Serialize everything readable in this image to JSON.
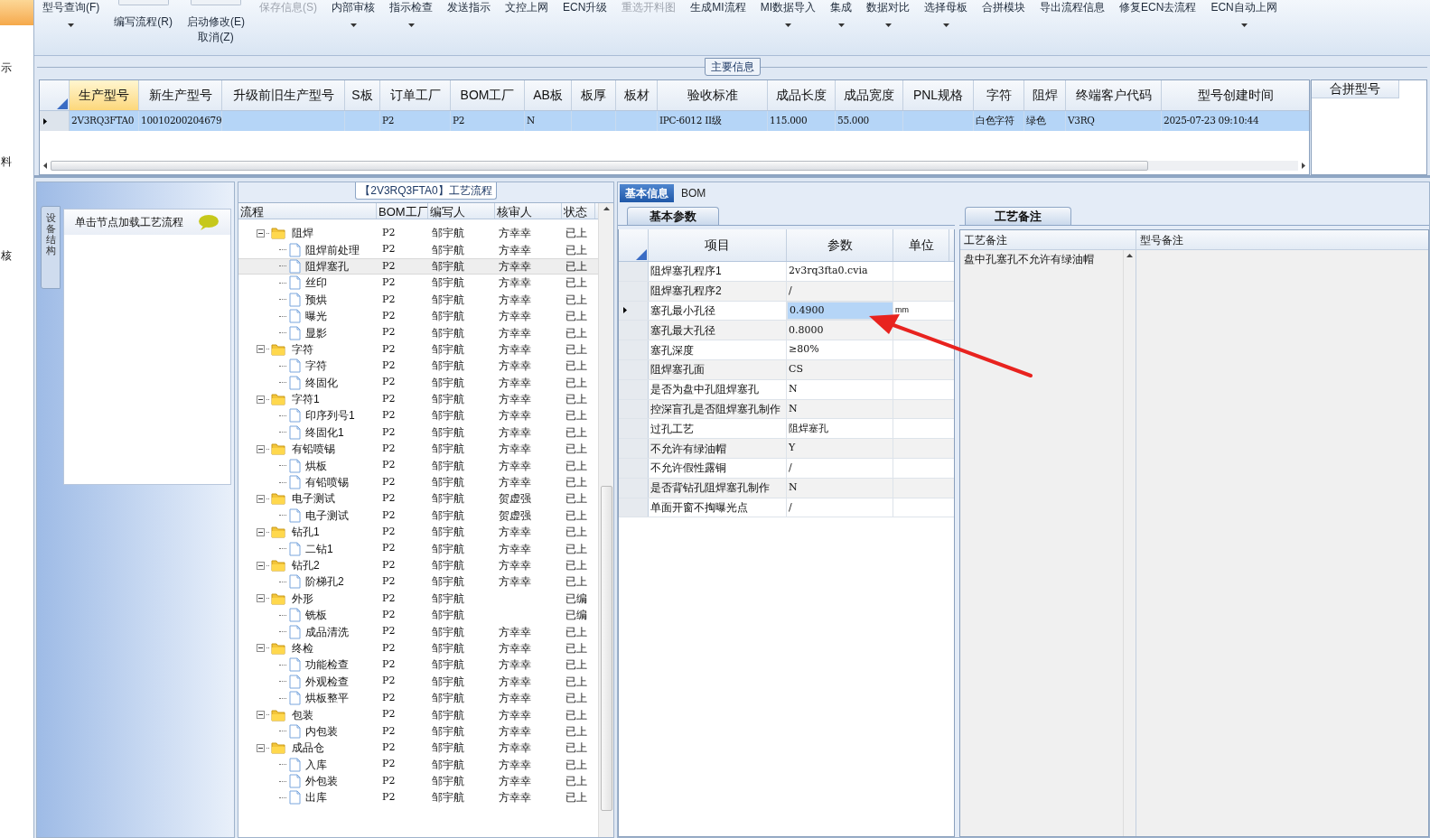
{
  "left_strip": {
    "items": [
      {
        "selected": true
      },
      {
        "label": "示",
        "selected": false
      },
      {
        "label": "料",
        "selected": false
      },
      {
        "label": "核",
        "selected": false
      }
    ]
  },
  "toolbar": [
    {
      "label": "型号查询(F)",
      "kind": "plain",
      "dropdown": true,
      "disabled": false
    },
    {
      "label": "编写流程(R)",
      "kind": "icon_top",
      "dropdown": false,
      "disabled": false
    },
    {
      "label": "启动修改(E)",
      "second_label": "取消(Z)",
      "kind": "icon_top",
      "dropdown": false,
      "disabled": false
    },
    {
      "label": "保存信息(S)",
      "kind": "plain",
      "dropdown": false,
      "disabled": true
    },
    {
      "label": "内部审核",
      "kind": "plain",
      "dropdown": true,
      "disabled": false
    },
    {
      "label": "指示检查",
      "kind": "plain",
      "dropdown": true,
      "disabled": false
    },
    {
      "label": "发送指示",
      "kind": "plain",
      "dropdown": false,
      "disabled": false
    },
    {
      "label": "文控上网",
      "kind": "plain",
      "dropdown": false,
      "disabled": false
    },
    {
      "label": "ECN升级",
      "kind": "plain",
      "dropdown": false,
      "disabled": false
    },
    {
      "label": "重选开料图",
      "kind": "plain",
      "dropdown": false,
      "disabled": true
    },
    {
      "label": "生成MI流程",
      "kind": "plain",
      "dropdown": false,
      "disabled": false
    },
    {
      "label": "MI数据导入",
      "kind": "plain",
      "dropdown": true,
      "disabled": false
    },
    {
      "label": "集成",
      "kind": "plain",
      "dropdown": true,
      "disabled": false
    },
    {
      "label": "数据对比",
      "kind": "plain",
      "dropdown": true,
      "disabled": false
    },
    {
      "label": "选择母板",
      "kind": "plain",
      "dropdown": true,
      "disabled": false
    },
    {
      "label": "合拼模块",
      "kind": "plain",
      "dropdown": false,
      "disabled": false
    },
    {
      "label": "导出流程信息",
      "kind": "plain",
      "dropdown": false,
      "disabled": false
    },
    {
      "label": "修复ECN去流程",
      "kind": "plain",
      "dropdown": false,
      "disabled": false
    },
    {
      "label": "ECN自动上网",
      "kind": "plain",
      "dropdown": true,
      "disabled": false
    }
  ],
  "main_info": {
    "title": "主要信息",
    "columns": [
      {
        "label": "生产型号",
        "selected": true
      },
      {
        "label": "新生产型号",
        "selected": false
      },
      {
        "label": "升级前旧生产型号",
        "selected": false
      },
      {
        "label": "S板",
        "selected": false
      },
      {
        "label": "订单工厂",
        "selected": false
      },
      {
        "label": "BOM工厂",
        "selected": false
      },
      {
        "label": "AB板",
        "selected": false
      },
      {
        "label": "板厚",
        "selected": false
      },
      {
        "label": "板材",
        "selected": false
      },
      {
        "label": "验收标准",
        "selected": false
      },
      {
        "label": "成品长度",
        "selected": false
      },
      {
        "label": "成品宽度",
        "selected": false
      },
      {
        "label": "PNL规格",
        "selected": false
      },
      {
        "label": "字符",
        "selected": false
      },
      {
        "label": "阻焊",
        "selected": false
      },
      {
        "label": "终端客户代码",
        "selected": false
      },
      {
        "label": "型号创建时间",
        "selected": false
      }
    ],
    "rows": [
      {
        "selected": true,
        "cells": [
          "2V3RQ3FTA0",
          "10010200204679",
          null,
          null,
          "P2",
          "P2",
          "N",
          null,
          null,
          "IPC-6012 II级",
          "115.000",
          "55.000",
          null,
          "白色字符",
          "绿色",
          "V3RQ",
          "2025-07-23 09:10:44"
        ]
      }
    ],
    "side_column": "合拼型号"
  },
  "left_panel": {
    "tab": "设备结构",
    "hint": "单击节点加载工艺流程"
  },
  "flow": {
    "title": "【2V3RQ3FTA0】工艺流程",
    "columns": [
      "流程",
      "BOM工厂",
      "编写人",
      "核审人",
      "状态"
    ],
    "nodes": [
      {
        "name": "阻焊",
        "bom": "P2",
        "writer": "邹宇航",
        "reviewer": "方幸幸",
        "status": "已上",
        "expanded": true,
        "selected": false,
        "children": [
          {
            "name": "阻焊前处理",
            "bom": "P2",
            "writer": "邹宇航",
            "reviewer": "方幸幸",
            "status": "已上",
            "selected": false
          },
          {
            "name": "阻焊塞孔",
            "bom": "P2",
            "writer": "邹宇航",
            "reviewer": "方幸幸",
            "status": "已上",
            "selected": true
          },
          {
            "name": "丝印",
            "bom": "P2",
            "writer": "邹宇航",
            "reviewer": "方幸幸",
            "status": "已上",
            "selected": false
          },
          {
            "name": "预烘",
            "bom": "P2",
            "writer": "邹宇航",
            "reviewer": "方幸幸",
            "status": "已上",
            "selected": false
          },
          {
            "name": "曝光",
            "bom": "P2",
            "writer": "邹宇航",
            "reviewer": "方幸幸",
            "status": "已上",
            "selected": false
          },
          {
            "name": "显影",
            "bom": "P2",
            "writer": "邹宇航",
            "reviewer": "方幸幸",
            "status": "已上",
            "selected": false
          }
        ]
      },
      {
        "name": "字符",
        "bom": "P2",
        "writer": "邹宇航",
        "reviewer": "方幸幸",
        "status": "已上",
        "expanded": true,
        "selected": false,
        "children": [
          {
            "name": "字符",
            "bom": "P2",
            "writer": "邹宇航",
            "reviewer": "方幸幸",
            "status": "已上",
            "selected": false
          },
          {
            "name": "终固化",
            "bom": "P2",
            "writer": "邹宇航",
            "reviewer": "方幸幸",
            "status": "已上",
            "selected": false
          }
        ]
      },
      {
        "name": "字符1",
        "bom": "P2",
        "writer": "邹宇航",
        "reviewer": "方幸幸",
        "status": "已上",
        "expanded": true,
        "selected": false,
        "children": [
          {
            "name": "印序列号1",
            "bom": "P2",
            "writer": "邹宇航",
            "reviewer": "方幸幸",
            "status": "已上",
            "selected": false
          },
          {
            "name": "终固化1",
            "bom": "P2",
            "writer": "邹宇航",
            "reviewer": "方幸幸",
            "status": "已上",
            "selected": false
          }
        ]
      },
      {
        "name": "有铅喷锡",
        "bom": "P2",
        "writer": "邹宇航",
        "reviewer": "方幸幸",
        "status": "已上",
        "expanded": true,
        "selected": false,
        "children": [
          {
            "name": "烘板",
            "bom": "P2",
            "writer": "邹宇航",
            "reviewer": "方幸幸",
            "status": "已上",
            "selected": false
          },
          {
            "name": "有铅喷锡",
            "bom": "P2",
            "writer": "邹宇航",
            "reviewer": "方幸幸",
            "status": "已上",
            "selected": false
          }
        ]
      },
      {
        "name": "电子测试",
        "bom": "P2",
        "writer": "邹宇航",
        "reviewer": "贺虚强",
        "status": "已上",
        "expanded": true,
        "selected": false,
        "children": [
          {
            "name": "电子测试",
            "bom": "P2",
            "writer": "邹宇航",
            "reviewer": "贺虚强",
            "status": "已上",
            "selected": false
          }
        ]
      },
      {
        "name": "钻孔1",
        "bom": "P2",
        "writer": "邹宇航",
        "reviewer": "方幸幸",
        "status": "已上",
        "expanded": true,
        "selected": false,
        "children": [
          {
            "name": "二钻1",
            "bom": "P2",
            "writer": "邹宇航",
            "reviewer": "方幸幸",
            "status": "已上",
            "selected": false
          }
        ]
      },
      {
        "name": "钻孔2",
        "bom": "P2",
        "writer": "邹宇航",
        "reviewer": "方幸幸",
        "status": "已上",
        "expanded": true,
        "selected": false,
        "children": [
          {
            "name": "阶梯孔2",
            "bom": "P2",
            "writer": "邹宇航",
            "reviewer": "方幸幸",
            "status": "已上",
            "selected": false
          }
        ]
      },
      {
        "name": "外形",
        "bom": "P2",
        "writer": "邹宇航",
        "status": "已编",
        "expanded": true,
        "selected": false,
        "children": [
          {
            "name": "铣板",
            "bom": "P2",
            "writer": "邹宇航",
            "status": "已编",
            "selected": false
          },
          {
            "name": "成品清洗",
            "bom": "P2",
            "writer": "邹宇航",
            "reviewer": "方幸幸",
            "status": "已上",
            "selected": false
          }
        ]
      },
      {
        "name": "终检",
        "bom": "P2",
        "writer": "邹宇航",
        "reviewer": "方幸幸",
        "status": "已上",
        "expanded": true,
        "selected": false,
        "children": [
          {
            "name": "功能检查",
            "bom": "P2",
            "writer": "邹宇航",
            "reviewer": "方幸幸",
            "status": "已上",
            "selected": false
          },
          {
            "name": "外观检查",
            "bom": "P2",
            "writer": "邹宇航",
            "reviewer": "方幸幸",
            "status": "已上",
            "selected": false
          },
          {
            "name": "烘板整平",
            "bom": "P2",
            "writer": "邹宇航",
            "reviewer": "方幸幸",
            "status": "已上",
            "selected": false
          }
        ]
      },
      {
        "name": "包装",
        "bom": "P2",
        "writer": "邹宇航",
        "reviewer": "方幸幸",
        "status": "已上",
        "expanded": true,
        "selected": false,
        "children": [
          {
            "name": "内包装",
            "bom": "P2",
            "writer": "邹宇航",
            "reviewer": "方幸幸",
            "status": "已上",
            "selected": false
          }
        ]
      },
      {
        "name": "成品仓",
        "bom": "P2",
        "writer": "邹宇航",
        "reviewer": "方幸幸",
        "status": "已上",
        "expanded": true,
        "selected": false,
        "children": [
          {
            "name": "入库",
            "bom": "P2",
            "writer": "邹宇航",
            "reviewer": "方幸幸",
            "status": "已上",
            "selected": false
          },
          {
            "name": "外包装",
            "bom": "P2",
            "writer": "邹宇航",
            "reviewer": "方幸幸",
            "status": "已上",
            "selected": false
          },
          {
            "name": "出库",
            "bom": "P2",
            "writer": "邹宇航",
            "reviewer": "方幸幸",
            "status": "已上",
            "selected": false
          }
        ]
      }
    ]
  },
  "detail_tabs": [
    {
      "label": "基本信息",
      "selected": true
    },
    {
      "label": "BOM",
      "selected": false
    }
  ],
  "params": {
    "title": "基本参数",
    "columns": [
      "项目",
      "参数",
      "单位"
    ],
    "rows": [
      {
        "item": "阻焊塞孔程序1",
        "value": "2v3rq3fta0.cvia",
        "selected": false
      },
      {
        "item": "阻焊塞孔程序2",
        "value": "/",
        "selected": false
      },
      {
        "item": "塞孔最小孔径",
        "value": "0.4900",
        "unit": "mm",
        "selected": true
      },
      {
        "item": "塞孔最大孔径",
        "value": "0.8000",
        "selected": false
      },
      {
        "item": "塞孔深度",
        "value": "≥80%",
        "selected": false
      },
      {
        "item": "阻焊塞孔面",
        "value": "CS",
        "selected": false
      },
      {
        "item": "是否为盘中孔阻焊塞孔",
        "value": "N",
        "selected": false
      },
      {
        "item": "控深盲孔是否阻焊塞孔制作",
        "value": "N",
        "selected": false
      },
      {
        "item": "过孔工艺",
        "value": "阻焊塞孔",
        "selected": false
      },
      {
        "item": "不允许有绿油帽",
        "value": "Y",
        "selected": false
      },
      {
        "item": "不允许假性露铜",
        "value": "/",
        "selected": false
      },
      {
        "item": "是否背钻孔阻焊塞孔制作",
        "value": "N",
        "selected": false
      },
      {
        "item": "单面开窗不掏曝光点",
        "value": "/",
        "selected": false
      }
    ]
  },
  "remarks": {
    "title": "工艺备注",
    "columns": [
      "工艺备注",
      "型号备注"
    ],
    "process_remark": "盘中孔塞孔不允许有绿油帽"
  }
}
